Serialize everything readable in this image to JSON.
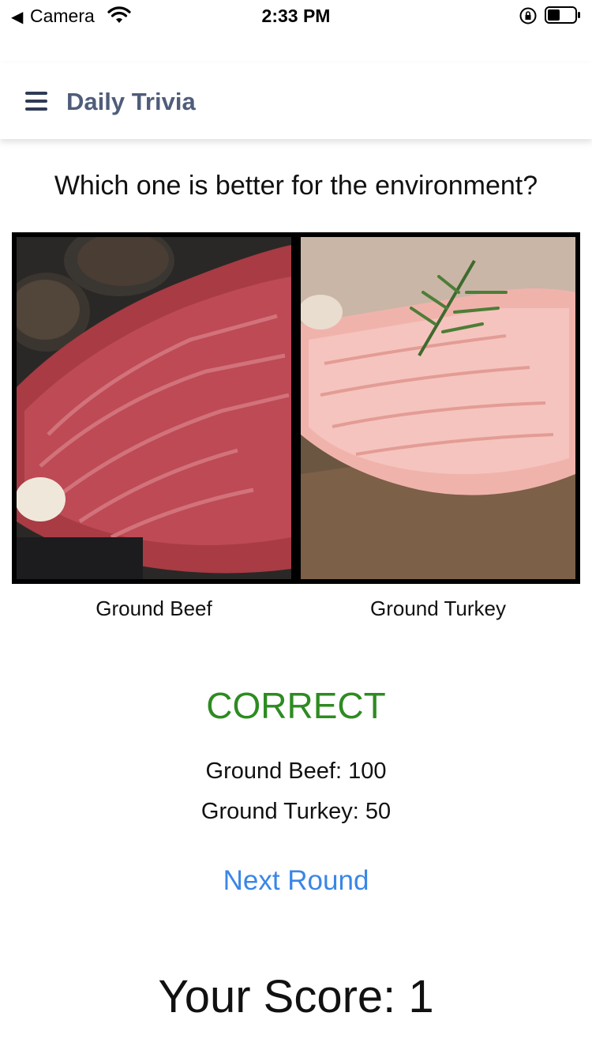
{
  "status_bar": {
    "back_label": "Camera",
    "time": "2:33 PM"
  },
  "header": {
    "menu_icon": "hamburger-icon",
    "title": "Daily Trivia"
  },
  "question": "Which one is better for the environment?",
  "choices": [
    {
      "label": "Ground Beef",
      "image": "ground-beef-photo"
    },
    {
      "label": "Ground Turkey",
      "image": "ground-turkey-photo"
    }
  ],
  "result": {
    "text": "CORRECT",
    "color": "#2e8b22"
  },
  "scores": [
    {
      "text": "Ground Beef: 100"
    },
    {
      "text": "Ground Turkey: 50"
    }
  ],
  "next_round_label": "Next Round",
  "your_score": "Your Score: 1",
  "colors": {
    "title": "#4f5d7a",
    "link": "#3a86e6",
    "correct": "#2e8b22"
  }
}
